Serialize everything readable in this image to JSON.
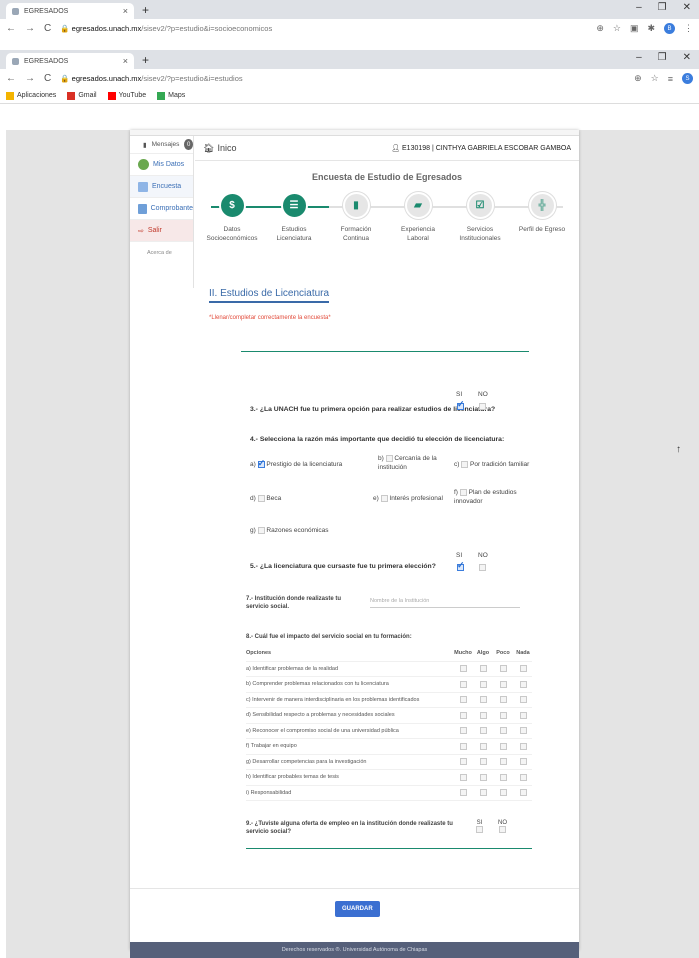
{
  "browser_back": {
    "tab_title": "EGRESADOS",
    "url_host": "egresados.unach.mx",
    "url_path": "/sisev2/?p=estudio&i=socioeconomicos",
    "avatar": "B"
  },
  "browser_front": {
    "tab_title": "EGRESADOS",
    "url_host": "egresados.unach.mx",
    "url_path": "/sisev2/?p=estudio&i=estudios",
    "avatar": "S"
  },
  "bookmarks": [
    {
      "label": "Aplicaciones",
      "color": "#f4b400"
    },
    {
      "label": "Gmail",
      "color": "#d93025"
    },
    {
      "label": "YouTube",
      "color": "#ff0000"
    },
    {
      "label": "Maps",
      "color": "#34a853"
    }
  ],
  "sidebar": {
    "messages_label": "Mensajes",
    "messages_count": "0",
    "items": [
      {
        "label": "Mis Datos",
        "icon": "gear-icon"
      },
      {
        "label": "Encuesta",
        "icon": "survey-icon"
      },
      {
        "label": "Comprobante",
        "icon": "document-icon"
      },
      {
        "label": "Salir",
        "icon": "logout-icon"
      }
    ],
    "about": "Acerca de"
  },
  "header": {
    "home": "Inico",
    "user": "E130198 | CINTHYA GABRIELA ESCOBAR GAMBOA"
  },
  "survey_title": "Encuesta de Estudio de Egresados",
  "wizard": [
    {
      "l1": "Datos",
      "l2": "Socioeconómicos",
      "icon": "$",
      "state": "done"
    },
    {
      "l1": "Estudios",
      "l2": "Licenciatura",
      "icon": "☰",
      "state": "current"
    },
    {
      "l1": "Formación",
      "l2": "Continua",
      "icon": "▮",
      "state": "todo"
    },
    {
      "l1": "Experiencia",
      "l2": "Laboral",
      "icon": "▰",
      "state": "todo"
    },
    {
      "l1": "Servicios",
      "l2": "Institucionales",
      "icon": "☑",
      "state": "todo"
    },
    {
      "l1": "Perfil de Egreso",
      "l2": "",
      "icon": "╬",
      "state": "todo"
    }
  ],
  "section_title": "II. Estudios de Licenciatura",
  "warning": "*Llenar/completar correctamente la encuesta*",
  "yes": "SI",
  "no": "NO",
  "q3": "3.- ¿La UNACH fue tu primera opción para realizar estudios de licenciatura?",
  "q4": "4.- Selecciona la razón más importante que decidió tu elección de licenciatura:",
  "q4_options": {
    "a": "Prestigio de la licenciatura",
    "b1": "Cercanía de la",
    "b2": "institución",
    "c": "Por tradición familiar",
    "d": "Beca",
    "e": "Interés profesional",
    "f1": "Plan de estudios",
    "f2": "innovador",
    "g": "Razones económicas"
  },
  "q4_letters": {
    "a": "a)",
    "b": "b)",
    "c": "c)",
    "d": "d)",
    "e": "e)",
    "f": "f)",
    "g": "g)"
  },
  "q5": "5.- ¿La licenciatura que cursaste fue tu primera elección?",
  "q7": "7.- Institución donde realizaste tu servicio social.",
  "q7_placeholder": "Nombre de la Institución",
  "q8": "8.- Cuál fue el impacto del servicio social en tu formación:",
  "q8_headers": {
    "opciones": "Opciones",
    "mucho": "Mucho",
    "algo": "Algo",
    "poco": "Poco",
    "nada": "Nada"
  },
  "q8_rows": [
    "a) Identificar problemas de la realidad",
    "b) Comprender problemas relacionados con tu licenciatura",
    "c) Intervenir de manera interdisciplinaria en los problemas identificados",
    "d) Sensibilidad respecto a problemas y necesidades sociales",
    "e) Reconocer el compromiso social de una universidad pública",
    "f) Trabajar en equipo",
    "g) Desarrollar competencias para la investigación",
    "h) Identificar probables temas de tesis",
    "i) Responsabilidad"
  ],
  "q9": "9.- ¿Tuviste alguna oferta de empleo en la institución donde realizaste tu servicio social?",
  "save": "GUARDAR",
  "footer": "Derechos reservados ®. Universidad Autónoma de Chiapas"
}
